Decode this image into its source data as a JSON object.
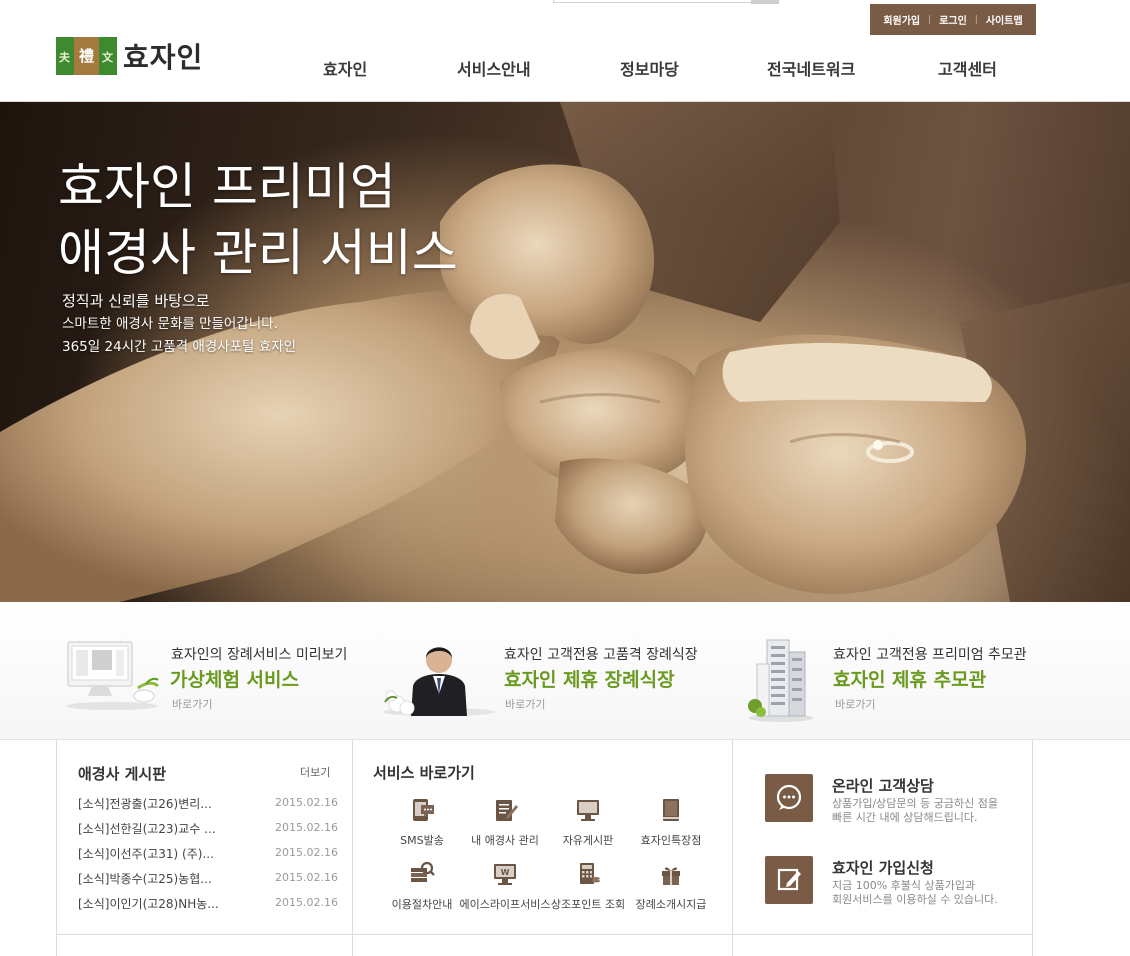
{
  "header": {
    "brand_name": "효자인",
    "util_links": [
      "회원가입",
      "로그인",
      "사이트맵"
    ],
    "nav": [
      "효자인",
      "서비스안내",
      "정보마당",
      "전국네트워크",
      "고객센터"
    ]
  },
  "hero": {
    "title_line1": "효자인 프리미엄",
    "title_line2": "애경사 관리 서비스",
    "desc_line1": "정직과 신뢰를 바탕으로",
    "desc_line2": "스마트한 애경사 문화를 만들어갑니다.",
    "desc_line3": "365일 24시간 고품격 애경사포털 효자인"
  },
  "promos": [
    {
      "pre": "효자인의 장례서비스 미리보기",
      "big": "가상체험 서비스",
      "go": "바로가기",
      "thumb_icon": "monitor-icon"
    },
    {
      "pre": "효자인 고객전용 고품격 장례식장",
      "big": "효자인 제휴 장례식장",
      "go": "바로가기",
      "thumb_icon": "person-icon"
    },
    {
      "pre": "효자인 고객전용 프리미엄 추모관",
      "big": "효자인 제휴 추모관",
      "go": "바로가기",
      "thumb_icon": "building-icon"
    }
  ],
  "notice": {
    "title": "애경사 게시판",
    "more": "더보기",
    "items": [
      {
        "title": "[소식]전광출(고26)변리...",
        "date": "2015.02.16"
      },
      {
        "title": "[소식]선한길(고23)교수 ...",
        "date": "2015.02.16"
      },
      {
        "title": "[소식]이선주(고31) (주)...",
        "date": "2015.02.16"
      },
      {
        "title": "[소식]박종수(고25)농협...",
        "date": "2015.02.16"
      },
      {
        "title": "[소식]이인기(고28)NH농...",
        "date": "2015.02.16"
      }
    ]
  },
  "services": {
    "title": "서비스 바로가기",
    "items": [
      {
        "label": "SMS발송",
        "icon": "sms-icon"
      },
      {
        "label": "내 애경사 관리",
        "icon": "notebook-edit-icon"
      },
      {
        "label": "자유게시판",
        "icon": "monitor-icon"
      },
      {
        "label": "효자인특장점",
        "icon": "book-icon"
      },
      {
        "label": "이용절차안내",
        "icon": "search-stack-icon"
      },
      {
        "label": "에이스라이프서비스",
        "icon": "monitor-w-icon"
      },
      {
        "label": "상조포인트 조회",
        "icon": "calculator-icon"
      },
      {
        "label": "장례소개시지급",
        "icon": "gift-icon"
      }
    ]
  },
  "cs": {
    "online": {
      "title": "온라인 고객상담",
      "desc1": "상품가입/상담문의 등 궁금하신 점을",
      "desc2": "빠른 시간 내에 상담해드립니다.",
      "icon": "chat-icon"
    },
    "join": {
      "title": "효자인 가입신청",
      "desc1": "지금 100% 후불식 상품가입과",
      "desc2": "회원서비스를 이용하실 수 있습니다.",
      "icon": "edit-icon"
    }
  },
  "colors": {
    "brand_brown": "#7a5b46",
    "accent_green": "#6a9a1f"
  }
}
